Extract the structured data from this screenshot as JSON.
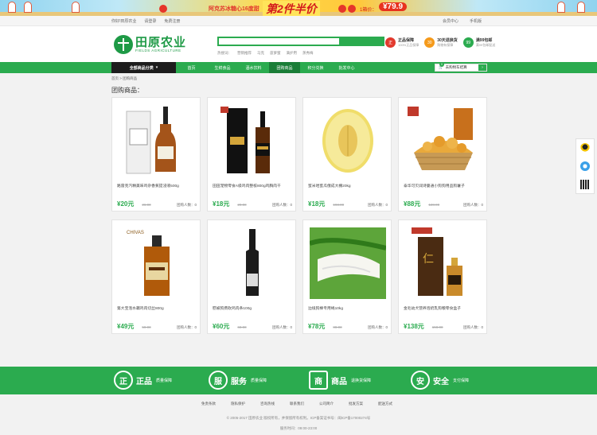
{
  "banner": {
    "text1": "阿克苏冰糖心16度甜",
    "text2": "第2件半价",
    "text3": "1箱价：",
    "price": "¥79.9"
  },
  "topbar": {
    "links_left": [
      "你好!田原农业",
      "请登录",
      "免费注册"
    ],
    "links_right": [
      "会员中心",
      "手机版"
    ]
  },
  "header": {
    "logo_cn": "田原农业",
    "logo_en": "FIELDS AGRICULTURE",
    "search_placeholder": "",
    "hot_label": "热搜词：",
    "hot_words": [
      "营销推荐",
      "马克",
      "菠萝蜜",
      "满护用",
      "蒸秀梅"
    ],
    "promises": [
      {
        "icon": "正",
        "title": "正品保障",
        "sub": "100%正品保障"
      },
      {
        "icon": "30",
        "title": "30天退换货",
        "sub": "购物有保障"
      },
      {
        "icon": "99",
        "title": "满99包邮",
        "sub": "满99包邮配送"
      }
    ]
  },
  "nav": {
    "category_label": "全部商品分类",
    "items": [
      "首页",
      "生鲜食品",
      "酒水饮料",
      "团购商品",
      "积分兑换",
      "批发中心"
    ],
    "active_index": 3,
    "cart_count": "0",
    "cart_label": "去购物车结算"
  },
  "breadcrumb": "首页 > 团购商品",
  "section_title": "团购商品：",
  "products": [
    {
      "name": "路雷克汽精美味鸡杂香蕉提浸液500g",
      "price": "¥20元",
      "old": "26.00",
      "sold": "团购人数：0",
      "img": "cognac"
    },
    {
      "name": "田田宠物零食A级鸡肉整核800g鸡胸肉干",
      "price": "¥18元",
      "old": "20.00",
      "sold": "团购人数：0",
      "img": "whisky"
    },
    {
      "name": "蜜米哈蜜瓜俄成大棚20kg",
      "price": "¥18元",
      "old": "193.00",
      "sold": "团购人数：0",
      "img": "melon"
    },
    {
      "name": "泰华可贝润诗曼通小狗狗用品狗薯子",
      "price": "¥88元",
      "old": "128.00",
      "sold": "团购人数：0",
      "img": "popcorn"
    },
    {
      "name": "第大宝泡水藕鸡肉切丝800g",
      "price": "¥49元",
      "old": "59.00",
      "sold": "团购人数：0",
      "img": "chivas"
    },
    {
      "name": "慰被狗费砍鸡肉条100g",
      "price": "¥60元",
      "old": "68.00",
      "sold": "团购人数：0",
      "img": "wine"
    },
    {
      "name": "边境狗棒专用绳10kg",
      "price": "¥78元",
      "old": "88.00",
      "sold": "团购人数：0",
      "img": "onion"
    },
    {
      "name": "金毛幼犬营养泡奶乳狗粮零食盒子",
      "price": "¥138元",
      "old": "158.00",
      "sold": "团购人数：0",
      "img": "liquor"
    }
  ],
  "footer": {
    "features": [
      {
        "icon": "正",
        "big": "正品",
        "small": "质量保障"
      },
      {
        "icon": "服",
        "big": "服务",
        "small": "质量保障"
      },
      {
        "icon": "商",
        "big": "商品",
        "small": "退换货保障"
      },
      {
        "icon": "安",
        "big": "安全",
        "small": "支付保障"
      }
    ],
    "links": [
      "免责条款",
      "隐私保护",
      "咨询热线",
      "联系我们",
      "公司简介",
      "批发方案",
      "配送方式"
    ],
    "copyright": "© 2005-2017 田原农业 版权所有，并保留所有权利。ICP备案证书号：闽ICP备17000274号",
    "hours": "服务时间：09:00-23:00"
  }
}
